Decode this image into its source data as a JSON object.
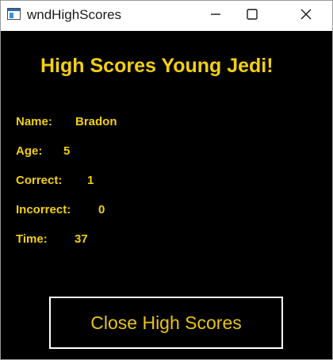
{
  "window": {
    "title": "wndHighScores",
    "icon": "window-app-icon",
    "controls": [
      "minimize-icon",
      "maximize-icon",
      "close-icon"
    ]
  },
  "heading": "High Scores Young Jedi!",
  "fields": [
    {
      "label": "Name:",
      "value": "Bradon"
    },
    {
      "label": "Age:",
      "value": "5"
    },
    {
      "label": "Correct:",
      "value": "1"
    },
    {
      "label": "Incorrect:",
      "value": "0"
    },
    {
      "label": "Time:",
      "value": "37"
    }
  ],
  "close_button_label": "Close High Scores",
  "colors": {
    "background": "#000000",
    "accent_text": "#f2cf12",
    "button_border": "#ffffff"
  }
}
